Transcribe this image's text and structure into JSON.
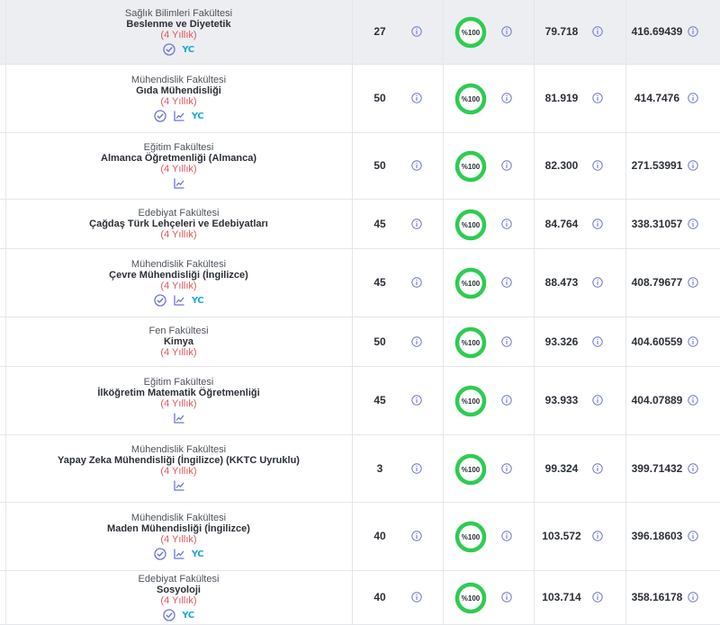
{
  "colors": {
    "badge_ring": "#2ecc52",
    "info_icon": "#6e74d6",
    "duration": "#e0555a",
    "yc_icon": "#1aa8d6"
  },
  "rows": [
    {
      "faculty": "Sağlık Bilimleri Fakültesi",
      "program": "Beslenme ve Diyetetik",
      "duration": "(4 Yıllık)",
      "quota": "27",
      "fill": "%100",
      "score": "79.718",
      "rank": "416.69439",
      "icons": [
        "check-icon",
        "yc-icon"
      ],
      "active": true
    },
    {
      "faculty": "Mühendislik Fakültesi",
      "program": "Gıda Mühendisliği",
      "duration": "(4 Yıllık)",
      "quota": "50",
      "fill": "%100",
      "score": "81.919",
      "rank": "414.7476",
      "icons": [
        "check-icon",
        "chart-icon",
        "yc-icon"
      ]
    },
    {
      "faculty": "Eğitim Fakültesi",
      "program": "Almanca Öğretmenliği (Almanca)",
      "duration": "(4 Yıllık)",
      "quota": "50",
      "fill": "%100",
      "score": "82.300",
      "rank": "271.53991",
      "icons": [
        "chart-icon"
      ]
    },
    {
      "faculty": "Edebiyat Fakültesi",
      "program": "Çağdaş Türk Lehçeleri ve Edebiyatları",
      "duration": "(4 Yıllık)",
      "quota": "45",
      "fill": "%100",
      "score": "84.764",
      "rank": "338.31057",
      "icons": []
    },
    {
      "faculty": "Mühendislik Fakültesi",
      "program": "Çevre Mühendisliği (İngilizce)",
      "duration": "(4 Yıllık)",
      "quota": "45",
      "fill": "%100",
      "score": "88.473",
      "rank": "408.79677",
      "icons": [
        "check-icon",
        "chart-icon",
        "yc-icon"
      ]
    },
    {
      "faculty": "Fen Fakültesi",
      "program": "Kimya",
      "duration": "(4 Yıllık)",
      "quota": "50",
      "fill": "%100",
      "score": "93.326",
      "rank": "404.60559",
      "icons": []
    },
    {
      "faculty": "Eğitim Fakültesi",
      "program": "İlköğretim Matematik Öğretmenliği",
      "duration": "(4 Yıllık)",
      "quota": "45",
      "fill": "%100",
      "score": "93.933",
      "rank": "404.07889",
      "icons": [
        "chart-icon"
      ]
    },
    {
      "faculty": "Mühendislik Fakültesi",
      "program": "Yapay Zeka Mühendisliği (İngilizce) (KKTC Uyruklu)",
      "duration": "(4 Yıllık)",
      "quota": "3",
      "fill": "%100",
      "score": "99.324",
      "rank": "399.71432",
      "icons": [
        "chart-icon"
      ]
    },
    {
      "faculty": "Mühendislik Fakültesi",
      "program": "Maden Mühendisliği (İngilizce)",
      "duration": "(4 Yıllık)",
      "quota": "40",
      "fill": "%100",
      "score": "103.572",
      "rank": "396.18603",
      "icons": [
        "check-icon",
        "chart-icon",
        "yc-icon"
      ]
    },
    {
      "faculty": "Edebiyat Fakültesi",
      "program": "Sosyoloji",
      "duration": "(4 Yıllık)",
      "quota": "40",
      "fill": "%100",
      "score": "103.714",
      "rank": "358.16178",
      "icons": [
        "check-icon",
        "yc-icon"
      ]
    }
  ]
}
